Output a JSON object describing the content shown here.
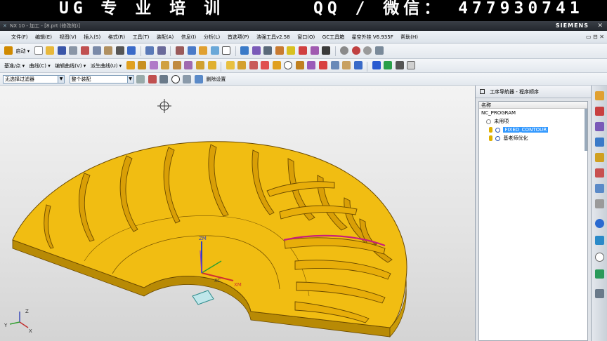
{
  "banner": {
    "left_text": "UG 专 业 培 训",
    "right_text": "QQ / 微信： 477930741"
  },
  "window": {
    "title": "NX 10 - 加工 - [8.prt (修改的)]",
    "brand": "SIEMENS",
    "close_glyph": "✕"
  },
  "menubar": {
    "items": [
      "文件(F)",
      "编辑(E)",
      "视图(V)",
      "插入(S)",
      "格式(R)",
      "工具(T)",
      "装配(A)",
      "信息(I)",
      "分析(L)",
      "首选项(P)",
      "浩强工具v2.58",
      "窗口(O)",
      "GC工具箱",
      "星空外挂 V6.935F",
      "帮助(H)"
    ],
    "controls": "▭ ⊟ ✕"
  },
  "toolbar1": {
    "start_label": "启动 ▾"
  },
  "toolbar2": {
    "labels": [
      "基准/点 ▾",
      "曲线(C) ▾",
      "编辑曲线(V) ▾",
      "派生曲线(U) ▾"
    ]
  },
  "filterbar": {
    "type_filter": "无选择过滤器",
    "scope_filter": "整个装配",
    "delete_setting": "删除设置"
  },
  "navigator": {
    "title": "工序导航器 - 程序顺序",
    "column_header": "名称",
    "rows": [
      "NC_PROGRAM",
      "未用项",
      "FIXED_CONTOUR",
      "基老师优化"
    ],
    "selected_index": 2
  },
  "viewport": {
    "csys_labels": {
      "zm": "ZM",
      "xc": "XC",
      "xm": "XM"
    },
    "triad_labels": {
      "z": "Z",
      "x": "X",
      "y": "Y"
    }
  },
  "colors": {
    "part_yellow": "#f1bd12",
    "part_edge": "#6b4a00",
    "toolpath": "#c8207a",
    "selection_blue": "#3399ff"
  },
  "icons": [
    "start-icon",
    "new-icon",
    "open-icon",
    "save-icon",
    "print-icon",
    "cut-icon",
    "copy-icon",
    "paste-icon",
    "delete-icon",
    "undo-icon",
    "redo-icon",
    "fit-view-icon",
    "rotate-icon",
    "cube-view-icon",
    "shaded-icon",
    "key-icon",
    "operation-icon",
    "crosshair-icon"
  ]
}
